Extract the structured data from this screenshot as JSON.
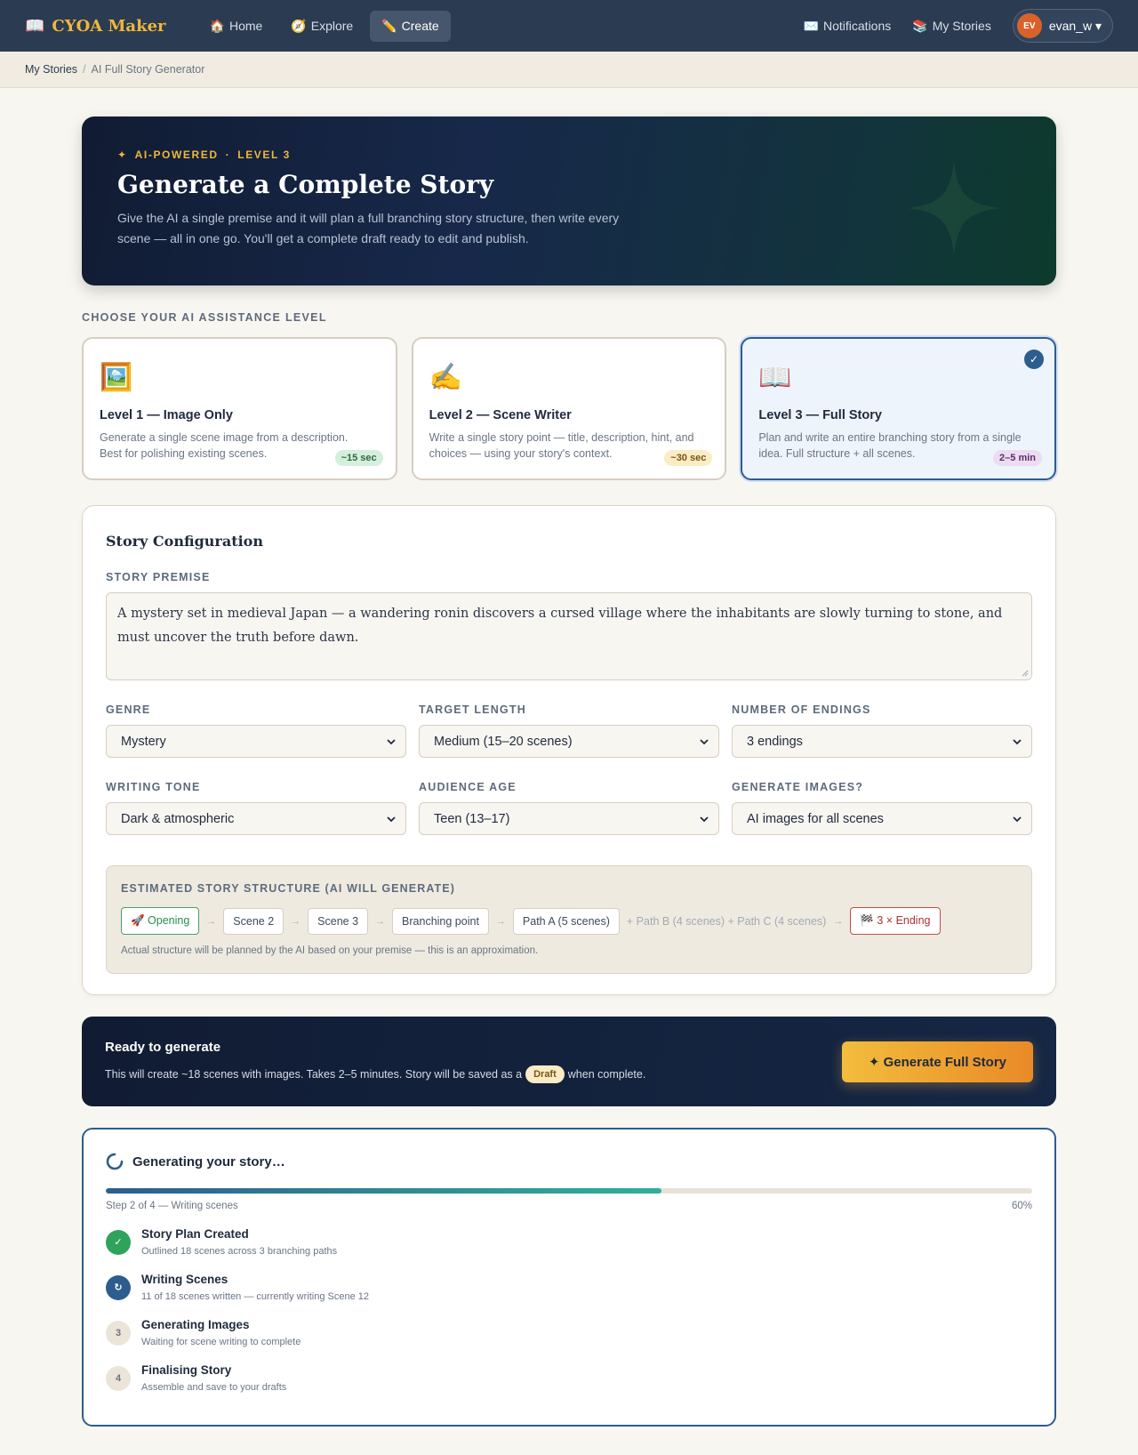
{
  "nav": {
    "brand_icon": "📖",
    "brand": "CYOA Maker",
    "links": [
      {
        "icon": "🏠",
        "label": "Home"
      },
      {
        "icon": "🧭",
        "label": "Explore"
      },
      {
        "icon": "✏️",
        "label": "Create"
      }
    ],
    "notifications_icon": "✉️",
    "notifications": "Notifications",
    "my_stories_icon": "📚",
    "my_stories": "My Stories",
    "avatar_initials": "EV",
    "username": "evan_w ▾"
  },
  "breadcrumb": {
    "parent": "My Stories",
    "separator": "/",
    "current": "AI Full Story Generator"
  },
  "hero": {
    "eyebrow_icon": "✦",
    "eyebrow_1": "AI-POWERED",
    "eyebrow_dot": "·",
    "eyebrow_2": "LEVEL 3",
    "title": "Generate a Complete Story",
    "description": "Give the AI a single premise and it will plan a full branching story structure, then write every scene — all in one go. You'll get a complete draft ready to edit and publish."
  },
  "levels_label": "CHOOSE YOUR AI ASSISTANCE LEVEL",
  "levels": [
    {
      "icon": "🖼️",
      "title": "Level 1 — Image Only",
      "description": "Generate a single scene image from a description. Best for polishing existing scenes.",
      "badge": "~15 sec",
      "selected": false
    },
    {
      "icon": "✍️",
      "title": "Level 2 — Scene Writer",
      "description": "Write a single story point — title, description, hint, and choices — using your story's context.",
      "badge": "~30 sec",
      "selected": false
    },
    {
      "icon": "📖",
      "title": "Level 3 — Full Story",
      "description": "Plan and write an entire branching story from a single idea. Full structure + all scenes.",
      "badge": "2–5 min",
      "selected": true,
      "check": "✓"
    }
  ],
  "config": {
    "title": "Story Configuration",
    "premise_label": "STORY PREMISE",
    "premise_value": "A mystery set in medieval Japan — a wandering ronin discovers a cursed village where the inhabitants are slowly turning to stone, and must uncover the truth before dawn.",
    "fields": [
      {
        "label": "GENRE",
        "value": "Mystery"
      },
      {
        "label": "TARGET LENGTH",
        "value": "Medium (15–20 scenes)"
      },
      {
        "label": "NUMBER OF ENDINGS",
        "value": "3 endings"
      },
      {
        "label": "WRITING TONE",
        "value": "Dark & atmospheric"
      },
      {
        "label": "AUDIENCE AGE",
        "value": "Teen (13–17)"
      },
      {
        "label": "GENERATE IMAGES?",
        "value": "AI images for all scenes"
      }
    ],
    "structure": {
      "label": "ESTIMATED STORY STRUCTURE (AI WILL GENERATE)",
      "nodes": [
        "🚀 Opening",
        "Scene 2",
        "Scene 3",
        "Branching point",
        "Path A (5 scenes)"
      ],
      "extra": "+ Path B (4 scenes) + Path C (4 scenes)",
      "ending": "🏁 3 × Ending",
      "arrow": "→",
      "note": "Actual structure will be planned by the AI based on your premise — this is an approximation."
    }
  },
  "ready": {
    "title": "Ready to generate",
    "text_before": "This will create ~18 scenes with images. Takes 2–5 minutes. Story will be saved as a",
    "pill": "Draft",
    "text_after": "when complete.",
    "button": "✦ Generate Full Story"
  },
  "progress": {
    "title": "Generating your story…",
    "step_text": "Step 2 of 4 — Writing scenes",
    "percent_label": "60%",
    "percent": 60,
    "steps": [
      {
        "marker": "✓",
        "title": "Story Plan Created",
        "detail": "Outlined 18 scenes across 3 branching paths",
        "state": "done"
      },
      {
        "marker": "↻",
        "title": "Writing Scenes",
        "detail": "11 of 18 scenes written — currently writing Scene 12",
        "state": "active"
      },
      {
        "marker": "3",
        "title": "Generating Images",
        "detail": "Waiting for scene writing to complete",
        "state": "pending"
      },
      {
        "marker": "4",
        "title": "Finalising Story",
        "detail": "Assemble and save to your drafts",
        "state": "pending"
      }
    ]
  },
  "colors": {
    "nav_bg": "#2b3b52",
    "brand": "#f0b73a",
    "accent_blue": "#2d5d8f",
    "success": "#2fa35c",
    "cta_start": "#f2bd3c",
    "cta_end": "#e98a27"
  }
}
